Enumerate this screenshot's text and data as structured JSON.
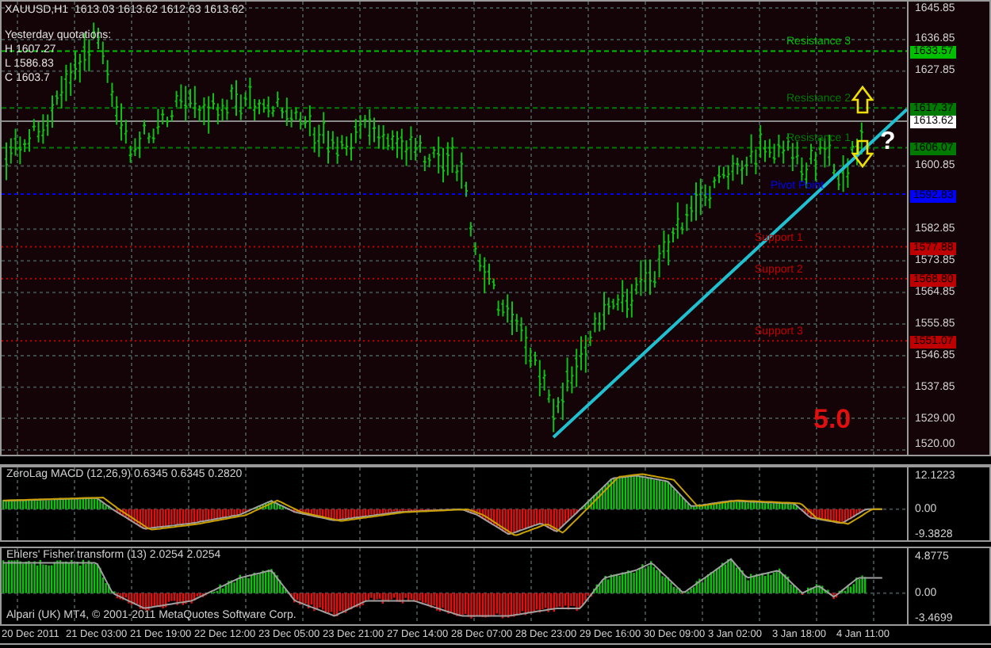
{
  "chart": {
    "symbol": "XAUUSD,H1",
    "quote": "1613.03 1613.62 1612.63 1613.62",
    "yesterday": {
      "heading": "Yesterday quotations:",
      "lines": [
        "H 1607.27",
        "L 1586.83",
        "C 1603.7"
      ]
    },
    "price_ticks": [
      "1645.85",
      "1636.85",
      "1627.85",
      "1600.85",
      "1582.85",
      "1573.85",
      "1564.85",
      "1555.85",
      "1546.85",
      "1537.85",
      "1529.00",
      "1520.00"
    ],
    "levels": [
      {
        "label": "Resistance 3",
        "price": "1633.57",
        "color": "#00c000",
        "kind": "resistance"
      },
      {
        "label": "Resistance 2",
        "price": "1617.37",
        "color": "#007a00",
        "kind": "resistance"
      },
      {
        "label": "Resistance 1",
        "price": "1606.07",
        "color": "#007a00",
        "kind": "resistance"
      },
      {
        "label": "Pivot Point",
        "price": "1592.83",
        "color": "#0000ff",
        "kind": "pivot"
      },
      {
        "label": "Support 1",
        "price": "1577.88",
        "color": "#c00000",
        "kind": "support"
      },
      {
        "label": "Support 2",
        "price": "1568.80",
        "color": "#c00000",
        "kind": "support"
      },
      {
        "label": "Support 3",
        "price": "1551.07",
        "color": "#c00000",
        "kind": "support"
      }
    ],
    "current_price": "1613.62",
    "question": "?",
    "score": "5.0"
  },
  "macd": {
    "title": "ZeroLag MACD (12,26,9) 0.6345 0.6345 0.2820",
    "ticks": [
      "12.1223",
      "0.00",
      "-9.3828"
    ]
  },
  "fisher": {
    "title": "Ehlers' Fisher transform (13) 2.0254 2.0254",
    "ticks": [
      "4.8775",
      "0.00",
      "-3.4699"
    ],
    "footer": "Alpari (UK) MT4, © 2001-2011 MetaQuotes Software Corp."
  },
  "time_axis": [
    "20 Dec 2011",
    "21 Dec 03:00",
    "21 Dec 19:00",
    "22 Dec 12:00",
    "23 Dec 05:00",
    "23 Dec 21:00",
    "27 Dec 14:00",
    "28 Dec 07:00",
    "28 Dec 23:00",
    "29 Dec 16:00",
    "30 Dec 09:00",
    "3 Jan 02:00",
    "3 Jan 18:00",
    "4 Jan 11:00"
  ]
}
